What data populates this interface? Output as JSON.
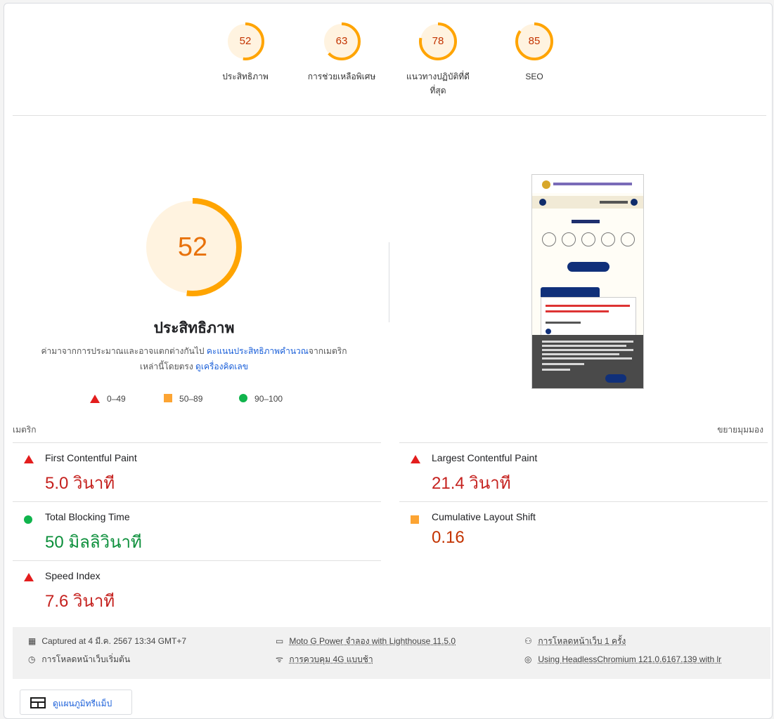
{
  "top_scores": [
    {
      "score": "52",
      "fraction": 0.52,
      "label": "ประสิทธิภาพ"
    },
    {
      "score": "63",
      "fraction": 0.63,
      "label": "การช่วยเหลือพิเศษ"
    },
    {
      "score": "78",
      "fraction": 0.78,
      "label": "แนวทางปฏิบัติที่ดีที่สุด"
    },
    {
      "score": "85",
      "fraction": 0.85,
      "label": "SEO"
    }
  ],
  "main": {
    "score": "52",
    "fraction": 0.52,
    "title": "ประสิทธิภาพ",
    "desc_prefix": "ค่ามาจากการประมาณและอาจแตกต่างกันไป ",
    "desc_link1": "คะแนนประสิทธิภาพคำนวณ",
    "desc_mid": "จากเมตริกเหล่านี้โดยตรง ",
    "desc_link2": "ดูเครื่องคิดเลข",
    "legend": [
      {
        "range": "0–49",
        "shape": "triangle",
        "color": "#e31d1d"
      },
      {
        "range": "50–89",
        "shape": "square",
        "color": "#fca433"
      },
      {
        "range": "90–100",
        "shape": "circle",
        "color": "#10b44c"
      }
    ]
  },
  "metrics_header": {
    "label": "เมตริก",
    "expand": "ขยายมุมมอง"
  },
  "metrics": [
    {
      "name": "First Contentful Paint",
      "value": "5.0 วินาที",
      "status": "bad"
    },
    {
      "name": "Largest Contentful Paint",
      "value": "21.4 วินาที",
      "status": "bad"
    },
    {
      "name": "Total Blocking Time",
      "value": "50 มิลลิวินาที",
      "status": "good"
    },
    {
      "name": "Cumulative Layout Shift",
      "value": "0.16",
      "status": "avg"
    },
    {
      "name": "Speed Index",
      "value": "7.6 วินาที",
      "status": "bad"
    }
  ],
  "footer": {
    "captured": "Captured at 4 มี.ค. 2567 13:34 GMT+7",
    "initial_load": "การโหลดหน้าเว็บเริ่มต้น",
    "device": "Moto G Power จำลอง with Lighthouse 11.5.0",
    "network": "การควบคุม 4G แบบช้า",
    "page_loads": "การโหลดหน้าเว็บ 1 ครั้ง",
    "browser": "Using HeadlessChromium 121.0.6167.139 with lr"
  },
  "treemap_button": "ดูแผนภูมิทรีแม็ป",
  "colors": {
    "average": "#ffa400",
    "bad": "#c5221f",
    "good": "#0c8f3b",
    "link": "#1a5fd9"
  }
}
